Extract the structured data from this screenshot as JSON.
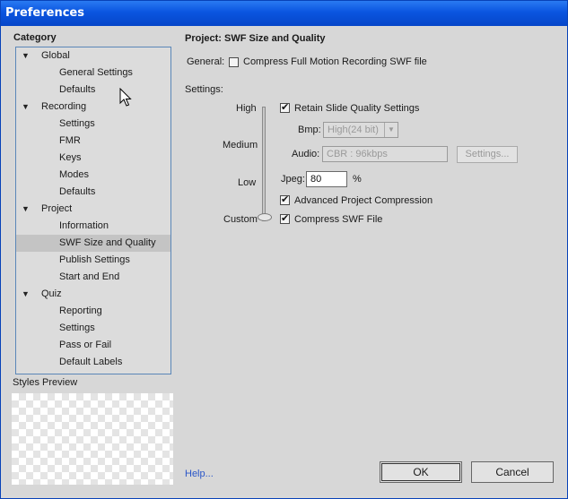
{
  "window": {
    "title": "Preferences"
  },
  "category": {
    "heading": "Category",
    "items": [
      {
        "label": "Global",
        "level": 0,
        "expanded": true
      },
      {
        "label": "General Settings",
        "level": 1
      },
      {
        "label": "Defaults",
        "level": 1
      },
      {
        "label": "Recording",
        "level": 0,
        "expanded": true
      },
      {
        "label": "Settings",
        "level": 1
      },
      {
        "label": "FMR",
        "level": 1
      },
      {
        "label": "Keys",
        "level": 1
      },
      {
        "label": "Modes",
        "level": 1
      },
      {
        "label": "Defaults",
        "level": 1
      },
      {
        "label": "Project",
        "level": 0,
        "expanded": true
      },
      {
        "label": "Information",
        "level": 1
      },
      {
        "label": "SWF Size and Quality",
        "level": 1,
        "selected": true
      },
      {
        "label": "Publish Settings",
        "level": 1
      },
      {
        "label": "Start and End",
        "level": 1
      },
      {
        "label": "Quiz",
        "level": 0,
        "expanded": true
      },
      {
        "label": "Reporting",
        "level": 1
      },
      {
        "label": "Settings",
        "level": 1
      },
      {
        "label": "Pass or Fail",
        "level": 1
      },
      {
        "label": "Default Labels",
        "level": 1
      }
    ]
  },
  "styles_preview": {
    "label": "Styles Preview"
  },
  "panel": {
    "title": "Project: SWF Size and Quality",
    "general_label": "General:",
    "compress_fmr_label": "Compress Full Motion Recording SWF file",
    "compress_fmr_checked": false,
    "settings_label": "Settings:",
    "quality_levels": [
      "High",
      "Medium",
      "Low",
      "Custom"
    ],
    "quality_selected": "Custom",
    "retain_label": "Retain Slide Quality Settings",
    "retain_checked": true,
    "bmp_label": "Bmp:",
    "bmp_value": "High(24 bit)",
    "audio_label": "Audio:",
    "audio_value": "CBR : 96kbps",
    "audio_settings_button": "Settings...",
    "jpeg_label": "Jpeg:",
    "jpeg_value": "80",
    "jpeg_unit": "%",
    "advanced_label": "Advanced Project Compression",
    "advanced_checked": true,
    "compress_swf_label": "Compress SWF File",
    "compress_swf_checked": true
  },
  "footer": {
    "help_link": "Help...",
    "ok_button": "OK",
    "cancel_button": "Cancel"
  },
  "colors": {
    "titlebar": "#0a55e0",
    "window_bg": "#d7d7d7",
    "tree_border": "#5a86b8",
    "link": "#2a56c8"
  }
}
